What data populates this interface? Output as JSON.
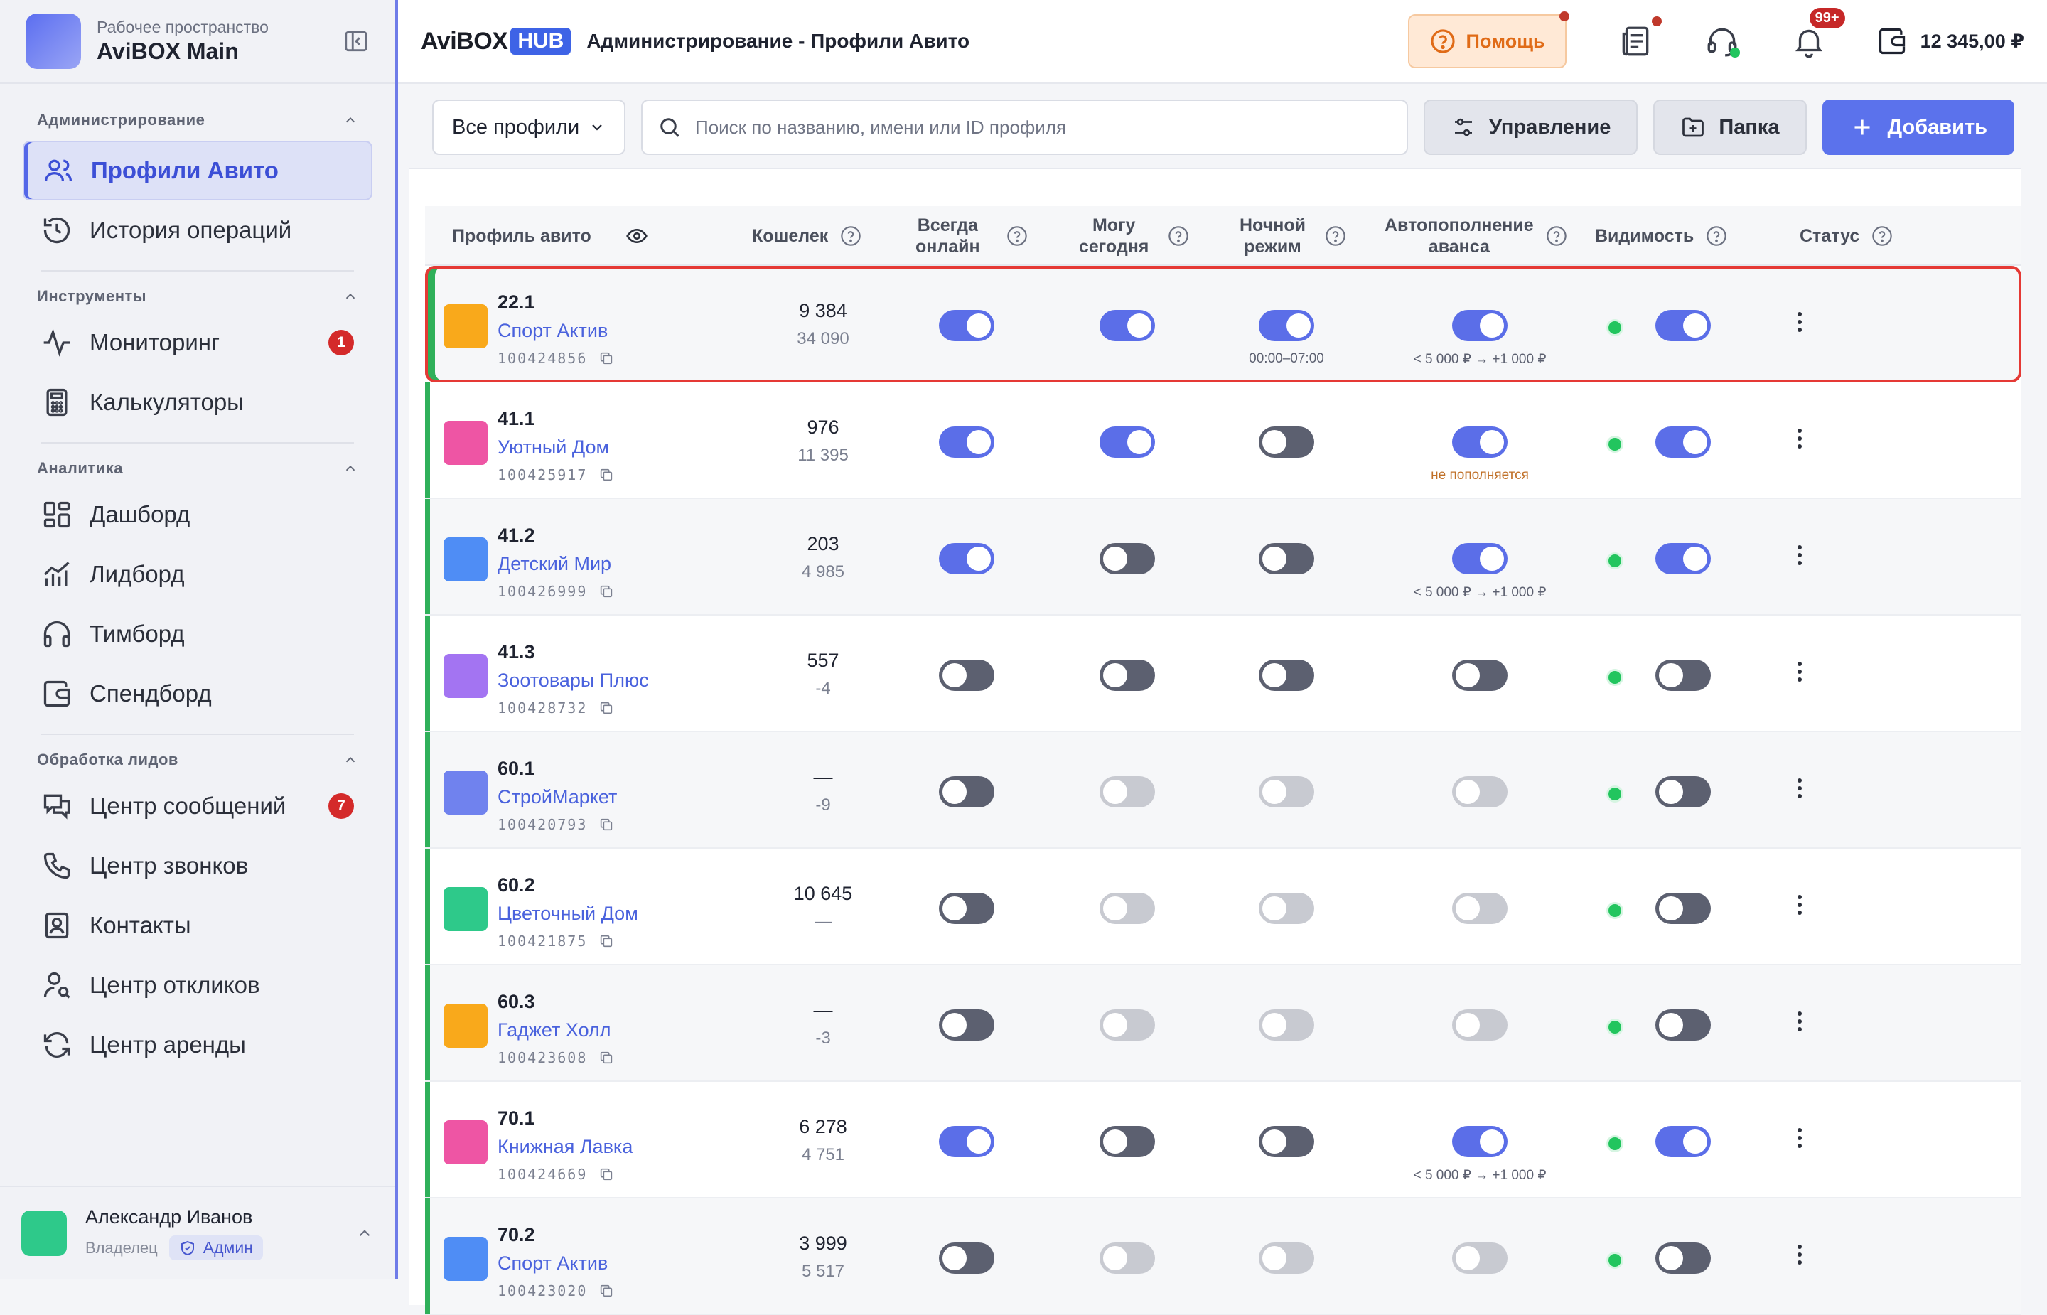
{
  "workspace": {
    "label": "Рабочее пространство",
    "name": "AviBOX Main"
  },
  "nav": {
    "admin_title": "Администрирование",
    "admin_items": [
      {
        "label": "Профили Авито"
      },
      {
        "label": "История операций"
      }
    ],
    "tools_title": "Инструменты",
    "tools_items": [
      {
        "label": "Мониторинг",
        "badge": "1"
      },
      {
        "label": "Калькуляторы"
      }
    ],
    "analytics_title": "Аналитика",
    "analytics_items": [
      {
        "label": "Дашборд"
      },
      {
        "label": "Лидборд"
      },
      {
        "label": "Тимборд"
      },
      {
        "label": "Спендборд"
      }
    ],
    "leads_title": "Обработка лидов",
    "leads_items": [
      {
        "label": "Центр сообщений",
        "badge": "7"
      },
      {
        "label": "Центр звонков"
      },
      {
        "label": "Контакты"
      },
      {
        "label": "Центр откликов"
      },
      {
        "label": "Центр аренды"
      }
    ]
  },
  "user": {
    "name": "Александр Иванов",
    "role": "Владелец",
    "badge": "Админ"
  },
  "header": {
    "brand_a": "AviBOX",
    "brand_b": "HUB",
    "breadcrumb": "Администрирование - Профили Авито",
    "help": "Помощь",
    "notif_badge": "99+",
    "balance": "12 345,00 ₽"
  },
  "toolbar": {
    "filter": "Все профили",
    "search_placeholder": "Поиск по названию, имени или ID профиля",
    "manage": "Управление",
    "folder": "Папка",
    "add": "Добавить"
  },
  "columns": {
    "profile": "Профиль авито",
    "wallet": "Кошелек",
    "always_online": [
      "Всегда",
      "онлайн"
    ],
    "can_today": [
      "Могу",
      "сегодня"
    ],
    "night_mode": [
      "Ночной",
      "режим"
    ],
    "autotopup": [
      "Автопополнение",
      "аванса"
    ],
    "visibility": "Видимость",
    "status": "Статус"
  },
  "colors": {
    "accent": "#5b6ee8",
    "active_row_border": "#e53935",
    "row_marker": "#2fb05a",
    "status_ok": "#22c55e"
  },
  "rows": [
    {
      "num": "22.1",
      "name": "Спорт Актив",
      "id": "100424856",
      "color": "#f9a91b",
      "w1": "9 384",
      "w2": "34 090",
      "online": "on",
      "today": "on",
      "night": "on",
      "night_sub": "00:00–07:00",
      "auto": "on",
      "auto_sub": "< 5 000 ₽ → +1 000 ₽",
      "vis": "on",
      "selected": true
    },
    {
      "num": "41.1",
      "name": "Уютный Дом",
      "id": "100425917",
      "color": "#ee55a4",
      "w1": "976",
      "w2": "11 395",
      "online": "on",
      "today": "on",
      "night": "off",
      "night_sub": "",
      "auto": "on",
      "auto_sub": "не пополняется",
      "auto_warn": true,
      "vis": "on"
    },
    {
      "num": "41.2",
      "name": "Детский Мир",
      "id": "100426999",
      "color": "#4f8df5",
      "w1": "203",
      "w2": "4 985",
      "online": "on",
      "today": "off",
      "night": "off",
      "night_sub": "",
      "auto": "on",
      "auto_sub": "< 5 000 ₽ → +1 000 ₽",
      "vis": "on"
    },
    {
      "num": "41.3",
      "name": "Зоотовары Плюс",
      "id": "100428732",
      "color": "#a374f2",
      "w1": "557",
      "w2": "-4",
      "online": "off",
      "today": "off",
      "night": "off",
      "night_sub": "",
      "auto": "off",
      "auto_sub": "",
      "vis": "off"
    },
    {
      "num": "60.1",
      "name": "СтройМаркет",
      "id": "100420793",
      "color": "#7082ee",
      "w1": "—",
      "w2": "-9",
      "online": "off",
      "today": "dis",
      "night": "dis",
      "night_sub": "",
      "auto": "dis",
      "auto_sub": "",
      "vis": "off"
    },
    {
      "num": "60.2",
      "name": "Цветочный Дом",
      "id": "100421875",
      "color": "#2ec98a",
      "w1": "10 645",
      "w2": "—",
      "online": "off",
      "today": "dis",
      "night": "dis",
      "night_sub": "",
      "auto": "dis",
      "auto_sub": "",
      "vis": "off"
    },
    {
      "num": "60.3",
      "name": "Гаджет Холл",
      "id": "100423608",
      "color": "#f9a91b",
      "w1": "—",
      "w2": "-3",
      "online": "off",
      "today": "dis",
      "night": "dis",
      "night_sub": "",
      "auto": "dis",
      "auto_sub": "",
      "vis": "off"
    },
    {
      "num": "70.1",
      "name": "Книжная Лавка",
      "id": "100424669",
      "color": "#ee55a4",
      "w1": "6 278",
      "w2": "4 751",
      "online": "on",
      "today": "off",
      "night": "off",
      "night_sub": "",
      "auto": "on",
      "auto_sub": "< 5 000 ₽ → +1 000 ₽",
      "vis": "on"
    },
    {
      "num": "70.2",
      "name": "Спорт Актив",
      "id": "100423020",
      "color": "#4f8df5",
      "w1": "3 999",
      "w2": "5 517",
      "online": "off",
      "today": "dis",
      "night": "dis",
      "night_sub": "",
      "auto": "dis",
      "auto_sub": "",
      "vis": "off"
    }
  ]
}
